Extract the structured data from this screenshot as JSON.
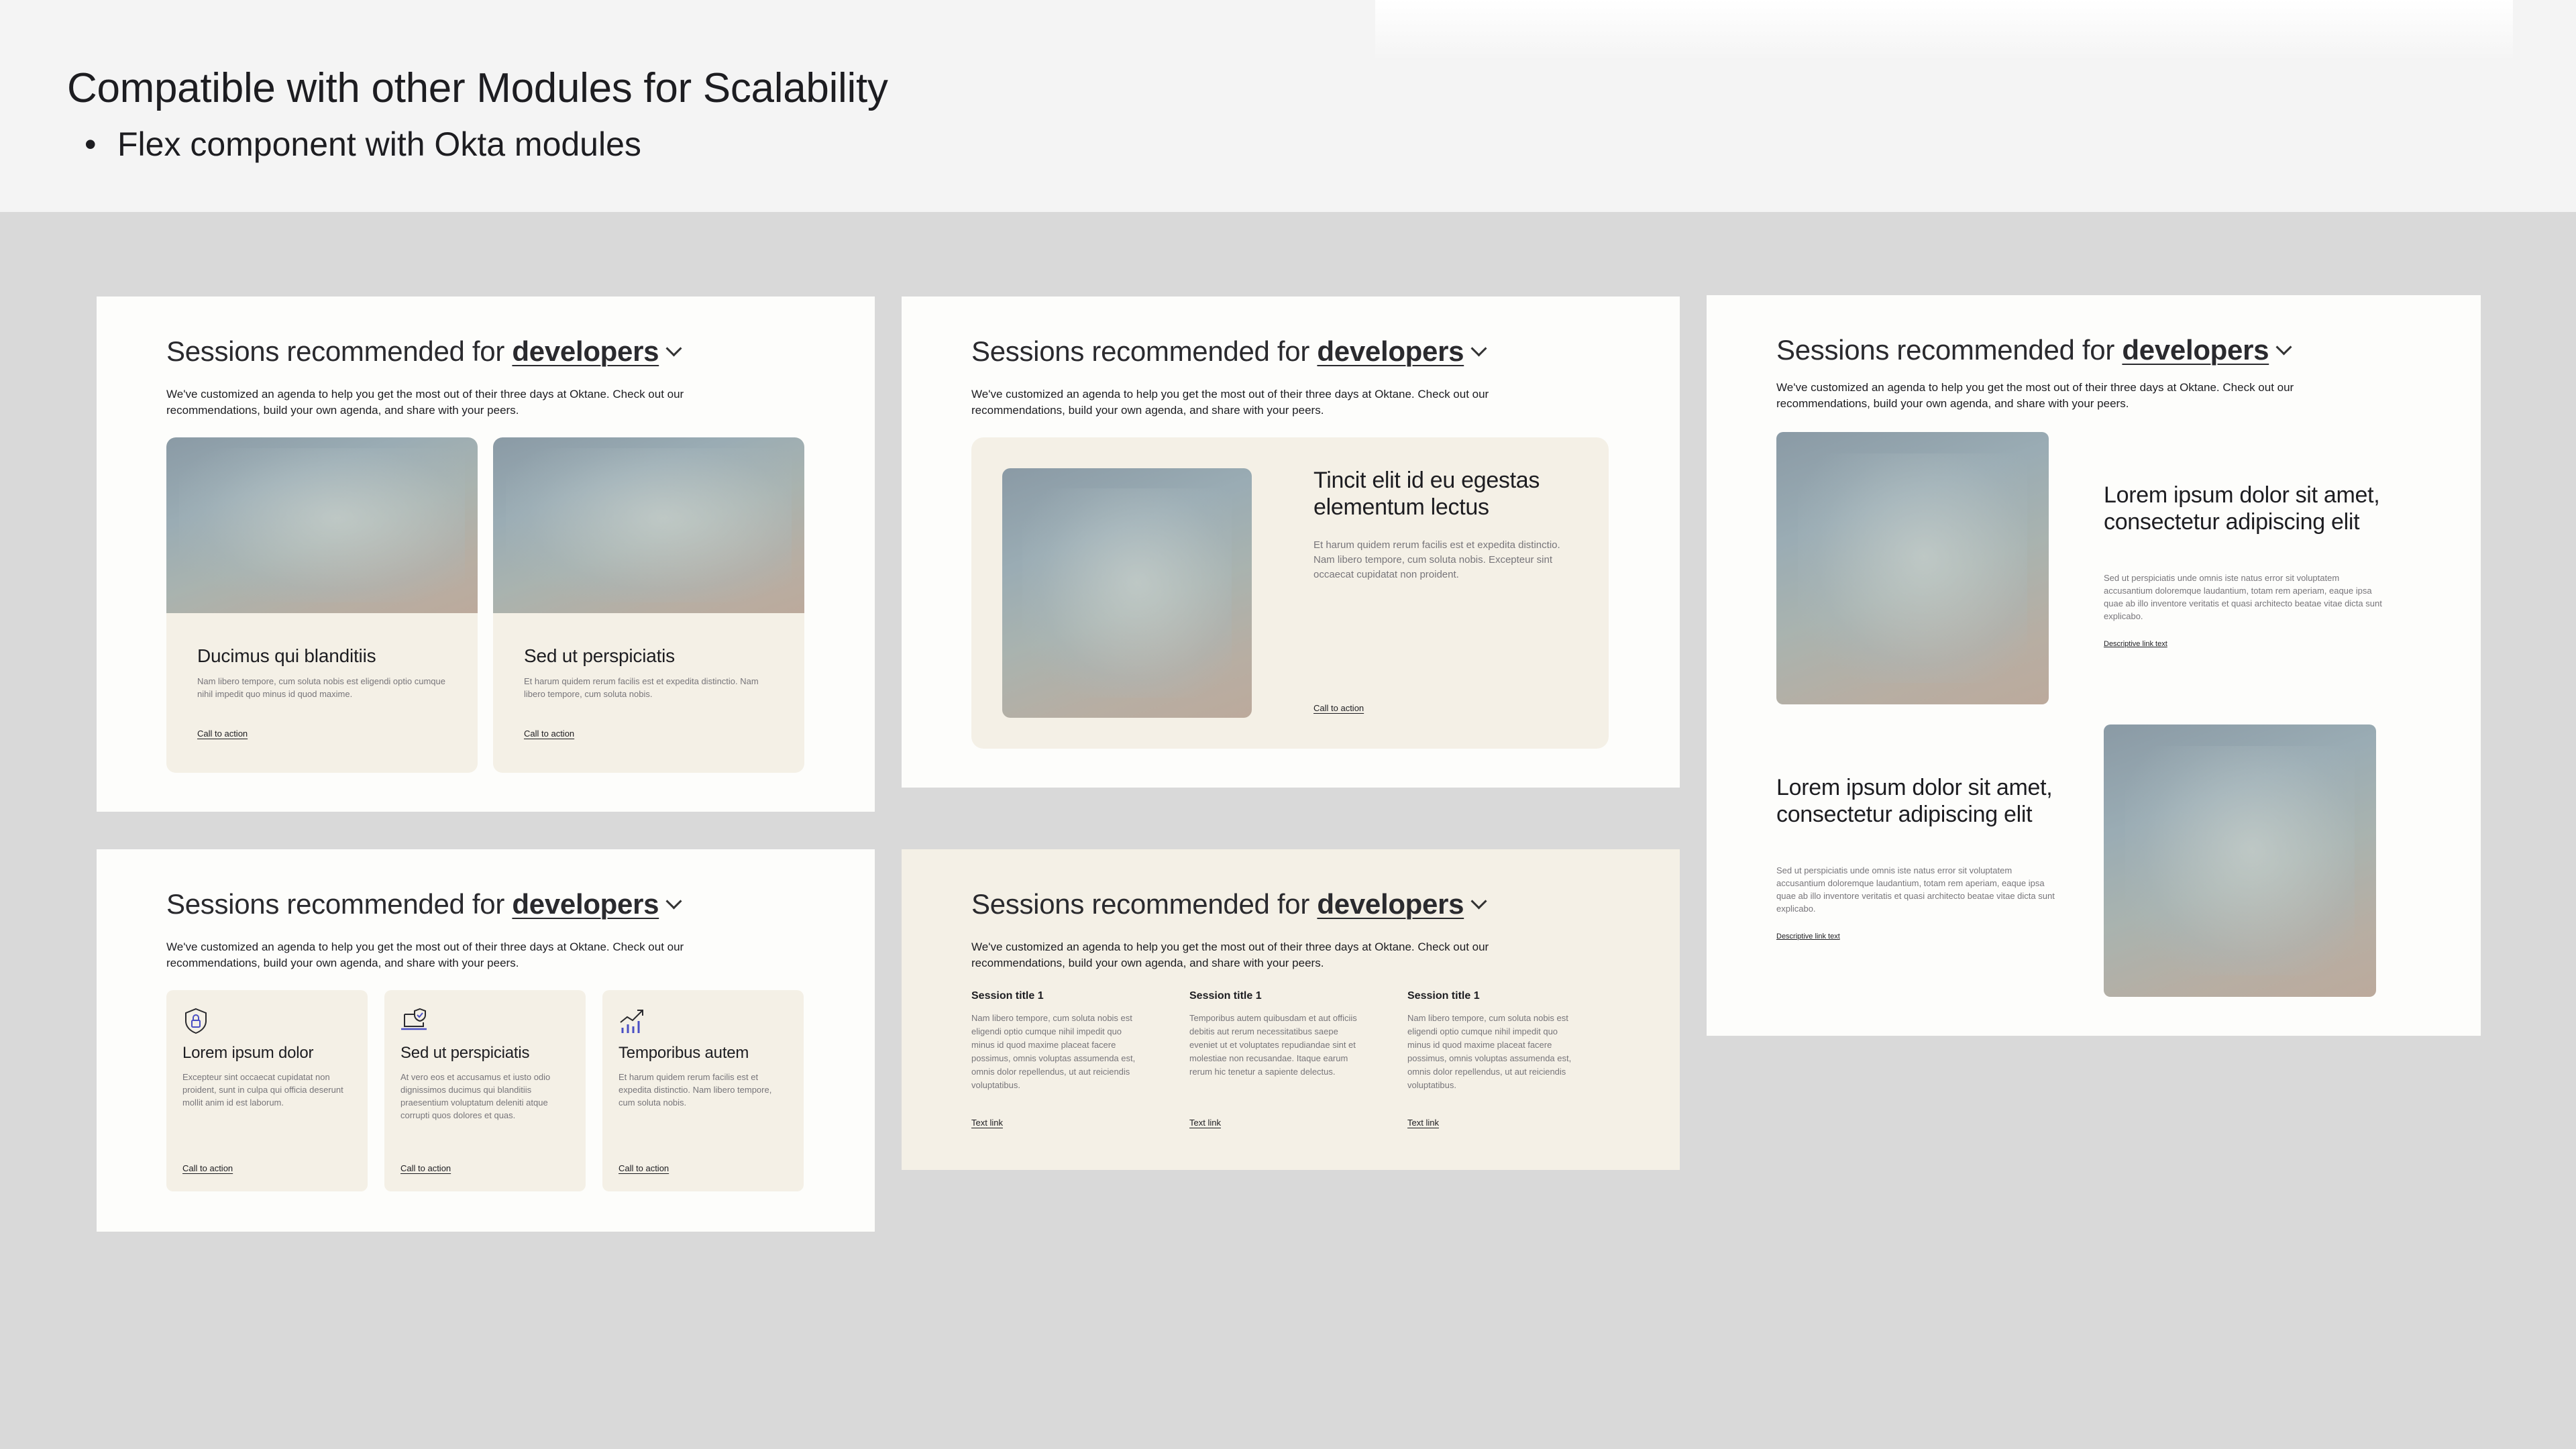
{
  "header": {
    "title": "Compatible with other Modules for Scalability",
    "bullet": "Flex component with Okta modules"
  },
  "section": {
    "title_prefix": "Sessions recommended for ",
    "audience": "developers",
    "intro": "We've customized an agenda to help you get the most out of their three days at Oktane. Check out our recommendations, build your own agenda, and share with your peers."
  },
  "panel1": {
    "cards": [
      {
        "title": "Ducimus qui blanditiis",
        "body": "Nam libero tempore, cum soluta nobis est eligendi optio cumque nihil impedit quo minus id quod maxime.",
        "cta": "Call to action"
      },
      {
        "title": "Sed ut perspiciatis",
        "body": "Et harum quidem rerum facilis est et expedita distinctio. Nam libero tempore, cum soluta nobis.",
        "cta": "Call to action"
      }
    ]
  },
  "panel2": {
    "title": "Tincit elit id eu egestas elementum lectus",
    "body": "Et harum quidem rerum facilis est et expedita distinctio. Nam libero tempore, cum soluta nobis. Excepteur sint occaecat cupidatat non proident.",
    "cta": "Call to action"
  },
  "panel3": {
    "rows": [
      {
        "title": "Lorem ipsum dolor sit amet, consectetur adipiscing elit",
        "body": "Sed ut perspiciatis unde omnis iste natus error sit voluptatem accusantium doloremque laudantium, totam rem aperiam, eaque ipsa quae ab illo inventore veritatis et quasi architecto beatae vitae dicta sunt explicabo.",
        "link": "Descriptive link text"
      },
      {
        "title": "Lorem ipsum dolor sit amet, consectetur adipiscing elit",
        "body": "Sed ut perspiciatis unde omnis iste natus error sit voluptatem accusantium doloremque laudantium, totam rem aperiam, eaque ipsa quae ab illo inventore veritatis et quasi architecto beatae vitae dicta sunt explicabo.",
        "link": "Descriptive link text"
      }
    ]
  },
  "panel4": {
    "cards": [
      {
        "icon": "shield-lock-icon",
        "title": "Lorem ipsum dolor",
        "body": "Excepteur sint occaecat cupidatat non proident, sunt in culpa qui officia deserunt mollit anim id est laborum.",
        "cta": "Call to action"
      },
      {
        "icon": "laptop-check-icon",
        "title": "Sed ut perspiciatis",
        "body": "At vero eos et accusamus et iusto odio dignissimos ducimus qui blanditiis praesentium voluptatum deleniti atque corrupti quos dolores et quas.",
        "cta": "Call to action"
      },
      {
        "icon": "growth-chart-icon",
        "title": "Temporibus autem",
        "body": "Et harum quidem rerum facilis est et expedita distinctio. Nam libero tempore, cum soluta nobis.",
        "cta": "Call to action"
      }
    ]
  },
  "panel5": {
    "columns": [
      {
        "title": "Session title 1",
        "body": "Nam libero tempore, cum soluta nobis est eligendi optio cumque nihil impedit quo minus id quod maxime placeat facere possimus, omnis voluptas assumenda est, omnis dolor repellendus, ut aut reiciendis voluptatibus.",
        "link": "Text link"
      },
      {
        "title": "Session title 1",
        "body": "Temporibus autem quibusdam et aut officiis debitis aut rerum necessitatibus saepe eveniet ut et voluptates repudiandae sint et molestiae non recusandae. Itaque earum rerum hic tenetur a sapiente delectus.",
        "link": "Text link"
      },
      {
        "title": "Session title 1",
        "body": "Nam libero tempore, cum soluta nobis est eligendi optio cumque nihil impedit quo minus id quod maxime placeat facere possimus, omnis voluptas assumenda est, omnis dolor repellendus, ut aut reiciendis voluptatibus.",
        "link": "Text link"
      }
    ]
  },
  "colors": {
    "canvas": "#d9d9d9",
    "header_bg": "#f4f4f4",
    "panel_bg": "#fdfdfb",
    "card_bg": "#f4f0e6",
    "icon_accent": "#4a4fc4"
  }
}
